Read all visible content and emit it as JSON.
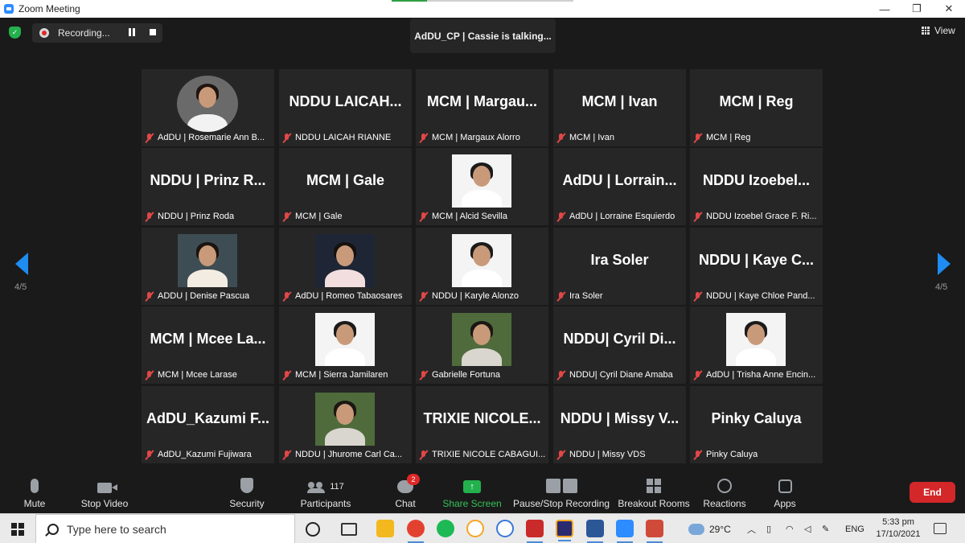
{
  "window": {
    "title": "Zoom Meeting",
    "controls": [
      "—",
      "❐",
      "✕"
    ]
  },
  "top_bar": {
    "recording_label": "Recording...",
    "talking_indicator": "AdDU_CP | Cassie is talking...",
    "view_label": "View"
  },
  "gallery": {
    "page_indicator_left": "4/5",
    "page_indicator_right": "4/5",
    "tiles": [
      {
        "big": "",
        "label": "AdDU | Rosemarie Ann B...",
        "photo": "round"
      },
      {
        "big": "NDDU  LAICAH...",
        "label": "NDDU LAICAH RIANNE"
      },
      {
        "big": "MCM | Margau...",
        "label": "MCM | Margaux Alorro"
      },
      {
        "big": "MCM | Ivan",
        "label": "MCM | Ivan"
      },
      {
        "big": "MCM | Reg",
        "label": "MCM | Reg"
      },
      {
        "big": "NDDU | Prinz R...",
        "label": "NDDU | Prinz Roda"
      },
      {
        "big": "MCM | Gale",
        "label": "MCM | Gale"
      },
      {
        "big": "",
        "label": "MCM | Alcid Sevilla",
        "photo": "light"
      },
      {
        "big": "AdDU | Lorrain...",
        "label": "AdDU | Lorraine Esquierdo"
      },
      {
        "big": "NDDU  Izoebel...",
        "label": "NDDU Izoebel Grace F. Ri..."
      },
      {
        "big": "",
        "label": "ADDU | Denise Pascua",
        "photo": "dark"
      },
      {
        "big": "",
        "label": "AdDU | Romeo Tabaosares",
        "photo": "night"
      },
      {
        "big": "",
        "label": "NDDU | Karyle Alonzo",
        "photo": "light"
      },
      {
        "big": "Ira Soler",
        "label": "Ira Soler"
      },
      {
        "big": "NDDU | Kaye C...",
        "label": "NDDU | Kaye Chloe Pand..."
      },
      {
        "big": "MCM | Mcee La...",
        "label": "MCM | Mcee Larase"
      },
      {
        "big": "",
        "label": "MCM | Sierra Jamilaren",
        "photo": "light"
      },
      {
        "big": "",
        "label": "Gabrielle Fortuna",
        "photo": "green"
      },
      {
        "big": "NDDU| Cyril Di...",
        "label": "NDDU| Cyril Diane Amaba"
      },
      {
        "big": "",
        "label": "AdDU | Trisha Anne Encin...",
        "photo": "light"
      },
      {
        "big": "AdDU_Kazumi  F...",
        "label": "AdDU_Kazumi Fujiwara"
      },
      {
        "big": "",
        "label": "NDDU | Jhurome Carl Ca...",
        "photo": "green"
      },
      {
        "big": "TRIXIE  NICOLE...",
        "label": "TRIXIE NICOLE CABAGUI..."
      },
      {
        "big": "NDDU | Missy V...",
        "label": "NDDU | Missy VDS"
      },
      {
        "big": "Pinky Caluya",
        "label": "Pinky Caluya"
      }
    ]
  },
  "toolbar": {
    "mute": "Mute",
    "stop_video": "Stop Video",
    "security": "Security",
    "participants": "Participants",
    "participants_count": "117",
    "chat": "Chat",
    "chat_badge": "2",
    "share_screen": "Share Screen",
    "pause_stop_recording": "Pause/Stop Recording",
    "breakout_rooms": "Breakout Rooms",
    "reactions": "Reactions",
    "apps": "Apps",
    "end": "End"
  },
  "taskbar": {
    "search_placeholder": "Type here to search",
    "weather": "29°C",
    "language": "ENG",
    "time": "5:33 pm",
    "date": "17/10/2021"
  },
  "colors": {
    "accent": "#2d8cff",
    "tile_bg": "#262626",
    "end_red": "#d3272a",
    "share_green": "#23b14d",
    "mic_off_red": "#e24747"
  }
}
